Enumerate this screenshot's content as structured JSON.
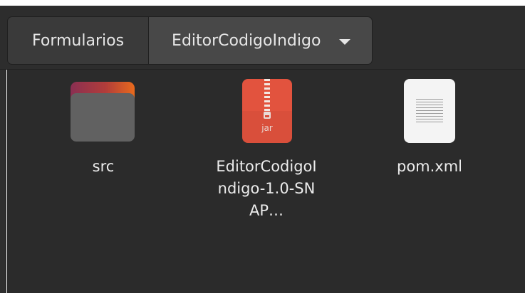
{
  "window": {
    "pathbar": {
      "crumbs": [
        {
          "label": "Formularios"
        },
        {
          "label": "EditorCodigoIndigo"
        }
      ],
      "dropdown_icon": "chevron-down-icon"
    },
    "files": [
      {
        "name": "src",
        "icon": "folder-icon"
      },
      {
        "name": "EditorCodigoIndigo-1.0-SNAP…",
        "icon": "jar-archive-icon",
        "badge": "jar"
      },
      {
        "name": "pom.xml",
        "icon": "text-document-icon"
      }
    ]
  },
  "colors": {
    "header": "#2d2d2d",
    "content": "#2b2b2b",
    "folder_accent": "#e86a1d",
    "jar": "#e2533e",
    "text": "#ececec"
  }
}
